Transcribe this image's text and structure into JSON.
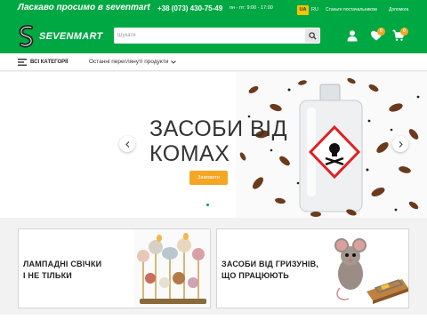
{
  "topbar": {
    "welcome": "Ласкаво просимо в sevenmart",
    "phone": "+38 (073) 430-75-49",
    "hours": "пн - пт: 9:00 - 17:00",
    "lang_active": "UA",
    "lang_other": "RU",
    "partner": "Станьте постачальником",
    "help": "Допомога"
  },
  "header": {
    "logo": "SEVENMART",
    "search_placeholder": "Шукати",
    "search_value": "",
    "wishlist_count": "0",
    "cart_count": "0"
  },
  "nav": {
    "categories": "ВСІ КАТЕГОРІЇ",
    "recent": "Останні переглянуті продукти"
  },
  "hero": {
    "title_line1": "ЗАСОБИ ВІД",
    "title_line2": "КОМАХ",
    "order_button": "Замовити"
  },
  "cards": [
    {
      "line1": "ЛАМПАДНІ СВІЧКИ",
      "line2": "І НЕ ТІЛЬКИ"
    },
    {
      "line1": "ЗАСОБИ ВІД ГРИЗУНІВ,",
      "line2": "ЩО ПРАЦЮЮТЬ"
    }
  ],
  "colors": {
    "brand_green": "#00a843",
    "accent_orange": "#f5a623",
    "lang_yellow": "#f5c400"
  }
}
